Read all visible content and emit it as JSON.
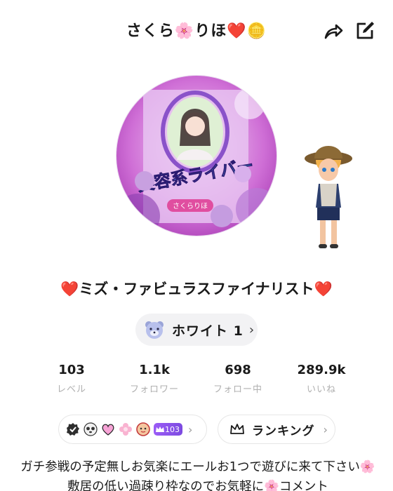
{
  "header": {
    "title": "さくら🌸りほ❤️🪙",
    "share_icon": "share-icon",
    "edit_icon": "edit-icon"
  },
  "avatar": {
    "banner_text": "美容系ライバー",
    "name_tag": "さくらりほ",
    "accent": "#b23fc2"
  },
  "profile": {
    "bio_title": "❤️ミズ・ファビュラスファイナリスト❤️",
    "rank_label": "ホワイト 1",
    "rank_chevron": "›"
  },
  "stats": [
    {
      "value": "103",
      "label": "レベル"
    },
    {
      "value": "1.1k",
      "label": "フォロワー"
    },
    {
      "value": "698",
      "label": "フォロー中"
    },
    {
      "value": "289.9k",
      "label": "いいね"
    }
  ],
  "badges": {
    "level": "103",
    "chevron": "›"
  },
  "ranking": {
    "label": "ランキング",
    "chevron": "›"
  },
  "description": "ガチ参戦の予定無しお気楽にエールお1つで遊びに来て下さい🌸敷居の低い過疎り枠なのでお気軽に🌸コメント"
}
